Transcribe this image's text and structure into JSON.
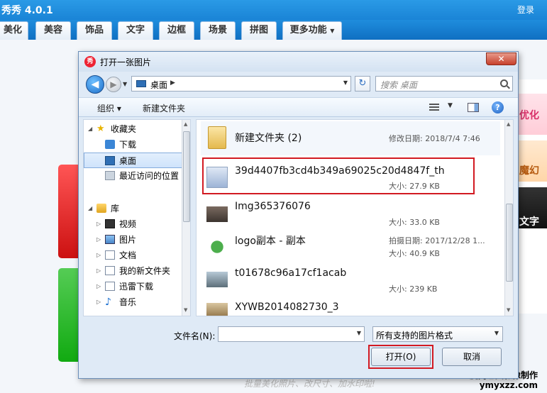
{
  "app": {
    "title": "秀秀 4.0.1",
    "login": "登录",
    "tabs": [
      "美化",
      "美容",
      "饰品",
      "文字",
      "边框",
      "场景",
      "拼图",
      "更多功能"
    ],
    "open_label": "打开",
    "bottom_text": "批量美化照片、改尺寸、加水印啦!",
    "right_panel": [
      "优化",
      "魔幻",
      "文字"
    ]
  },
  "watermark": {
    "line1": "厦门艺美影像制作",
    "line2": "ymyxzz.com"
  },
  "dialog": {
    "title": "打开一张图片",
    "app_icon": "秀",
    "close": "✕",
    "address": "桌面",
    "search_placeholder": "搜索 桌面",
    "toolbar": {
      "organize": "组织 ▾",
      "new_folder": "新建文件夹"
    },
    "nav": {
      "favorites": "收藏夹",
      "downloads": "下载",
      "desktop": "桌面",
      "recent": "最近访问的位置",
      "libraries": "库",
      "videos": "视频",
      "pictures": "图片",
      "documents": "文档",
      "my_new_folder": "我的新文件夹",
      "xunlei": "迅雷下载",
      "music": "音乐"
    },
    "files": [
      {
        "name": "新建文件夹 (2)",
        "meta1": "修改日期: 2018/7/4 7:46",
        "meta2": ""
      },
      {
        "name": "39d4407fb3cd4b349a69025c20d4847f_th",
        "meta1": "",
        "meta2": "大小: 27.9 KB"
      },
      {
        "name": "Img365376076",
        "meta1": "",
        "meta2": "大小: 33.0 KB"
      },
      {
        "name": "logo副本 - 副本",
        "meta1": "拍摄日期: 2017/12/28 1...",
        "meta2": "大小: 40.9 KB"
      },
      {
        "name": "t01678c96a17cf1acab",
        "meta1": "",
        "meta2": "大小: 239 KB"
      },
      {
        "name": "XYWB2014082730_3",
        "meta1": "",
        "meta2": ""
      }
    ],
    "filename_label": "文件名(N):",
    "filename_value": "",
    "filetype": "所有支持的图片格式",
    "open_button": "打开(O)",
    "cancel_button": "取消"
  },
  "colors": {
    "accent_blue": "#1a84d6",
    "highlight_red": "#d21a22"
  }
}
